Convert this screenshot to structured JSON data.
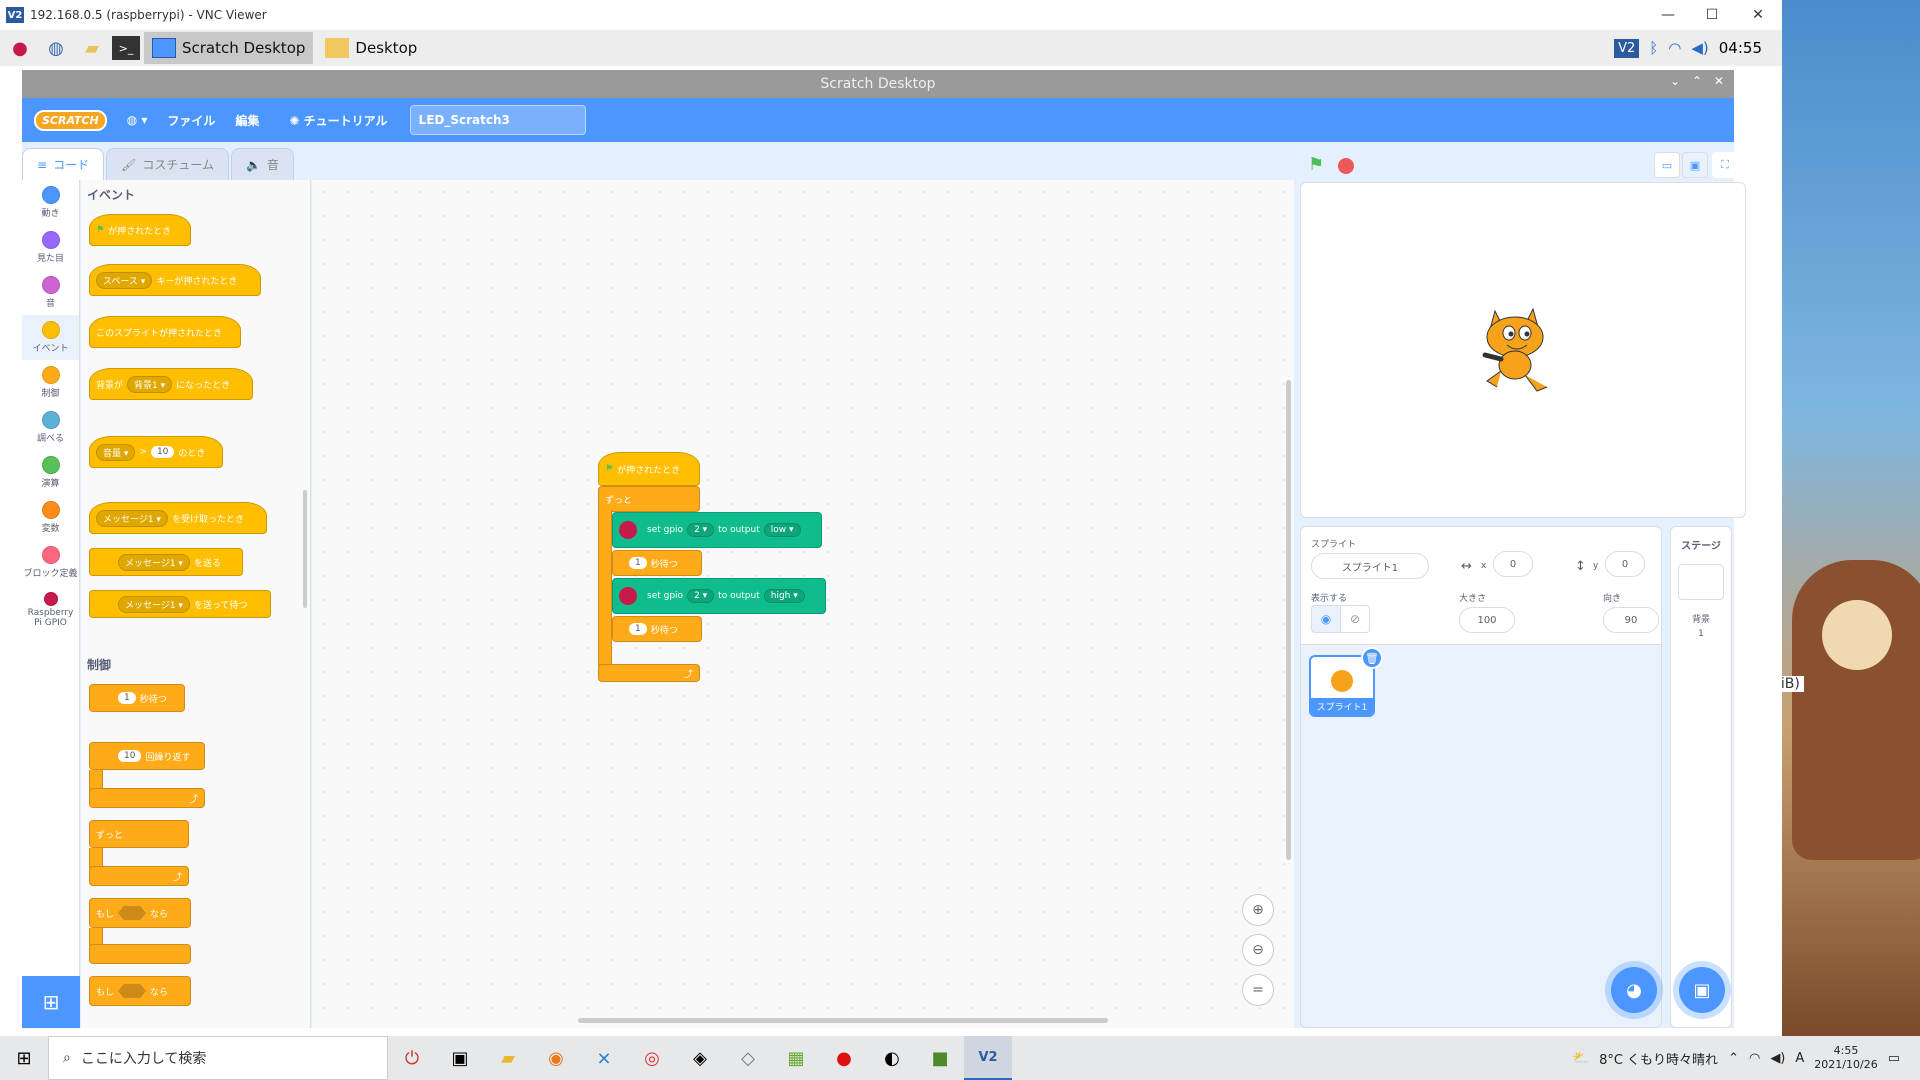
{
  "vnc": {
    "title": "192.168.0.5 (raspberrypi) - VNC Viewer",
    "logo": "V2"
  },
  "pi_taskbar": {
    "tasks": [
      {
        "label": "Scratch Desktop",
        "active": true
      },
      {
        "label": "Desktop",
        "active": false
      }
    ],
    "time": "04:55",
    "icons": [
      "raspberry-menu-icon",
      "globe-icon",
      "folder-icon",
      "terminal-icon"
    ]
  },
  "scratch": {
    "window_title": "Scratch Desktop",
    "menu": {
      "logo": "SCRATCH",
      "file": "ファイル",
      "edit": "編集",
      "tutorials": "チュートリアル",
      "project_name": "LED_Scratch3"
    },
    "tabs": {
      "code": "コード",
      "costumes": "コスチューム",
      "sounds": "音"
    },
    "categories": [
      {
        "label": "動き",
        "color": "#4c97ff"
      },
      {
        "label": "見た目",
        "color": "#9966ff"
      },
      {
        "label": "音",
        "color": "#cf63cf"
      },
      {
        "label": "イベント",
        "color": "#ffbf00"
      },
      {
        "label": "制御",
        "color": "#ffab19"
      },
      {
        "label": "調べる",
        "color": "#5cb1d6"
      },
      {
        "label": "演算",
        "color": "#59c059"
      },
      {
        "label": "変数",
        "color": "#ff8c1a"
      },
      {
        "label": "ブロック定義",
        "color": "#ff6680"
      },
      {
        "label": "Raspberry Pi GPIO",
        "color": "#c51a4a"
      }
    ],
    "palette": {
      "events_title": "イベント",
      "flag_clicked": "が押されたとき",
      "key_dd": "スペース",
      "key_pressed": "キーが押されたとき",
      "sprite_clicked": "このスプライトが押されたとき",
      "backdrop_prefix": "背景が",
      "backdrop_dd": "背景1",
      "backdrop_suffix": "になったとき",
      "loud_dd": "音量",
      "gt": ">",
      "loud_val": "10",
      "loud_suffix": "のとき",
      "msg_dd": "メッセージ1",
      "receive": "を受け取ったとき",
      "broadcast": "を送る",
      "broadcast_wait": "を送って待つ",
      "control_title": "制御",
      "wait_val": "1",
      "wait": "秒待つ",
      "repeat_val": "10",
      "repeat": "回繰り返す",
      "forever": "ずっと",
      "if": "もし",
      "then": "なら"
    },
    "script": {
      "hat": "が押されたとき",
      "forever": "ずっと",
      "set1": {
        "prefix": "set gpio",
        "pin": "2",
        "mid": "to output",
        "state": "low"
      },
      "wait1": {
        "val": "1",
        "label": "秒待つ"
      },
      "set2": {
        "prefix": "set gpio",
        "pin": "2",
        "mid": "to output",
        "state": "high"
      },
      "wait2": {
        "val": "1",
        "label": "秒待つ"
      }
    },
    "sprite_info": {
      "sprite_label": "スプライト",
      "sprite_name": "スプライト1",
      "x_label": "x",
      "x": "0",
      "y_label": "y",
      "y": "0",
      "show_label": "表示する",
      "size_label": "大きさ",
      "size": "100",
      "dir_label": "向き",
      "dir": "90"
    },
    "sprite_thumb": "スプライト1",
    "stage_pane": {
      "title": "ステージ",
      "backdrops_label": "背景",
      "backdrops_count": "1"
    }
  },
  "win_taskbar": {
    "search_placeholder": "ここに入力して検索",
    "weather": "8°C くもり時々晴れ",
    "time": "4:55",
    "date": "2021/10/26",
    "ime": "A"
  },
  "background_text": "GiB)"
}
